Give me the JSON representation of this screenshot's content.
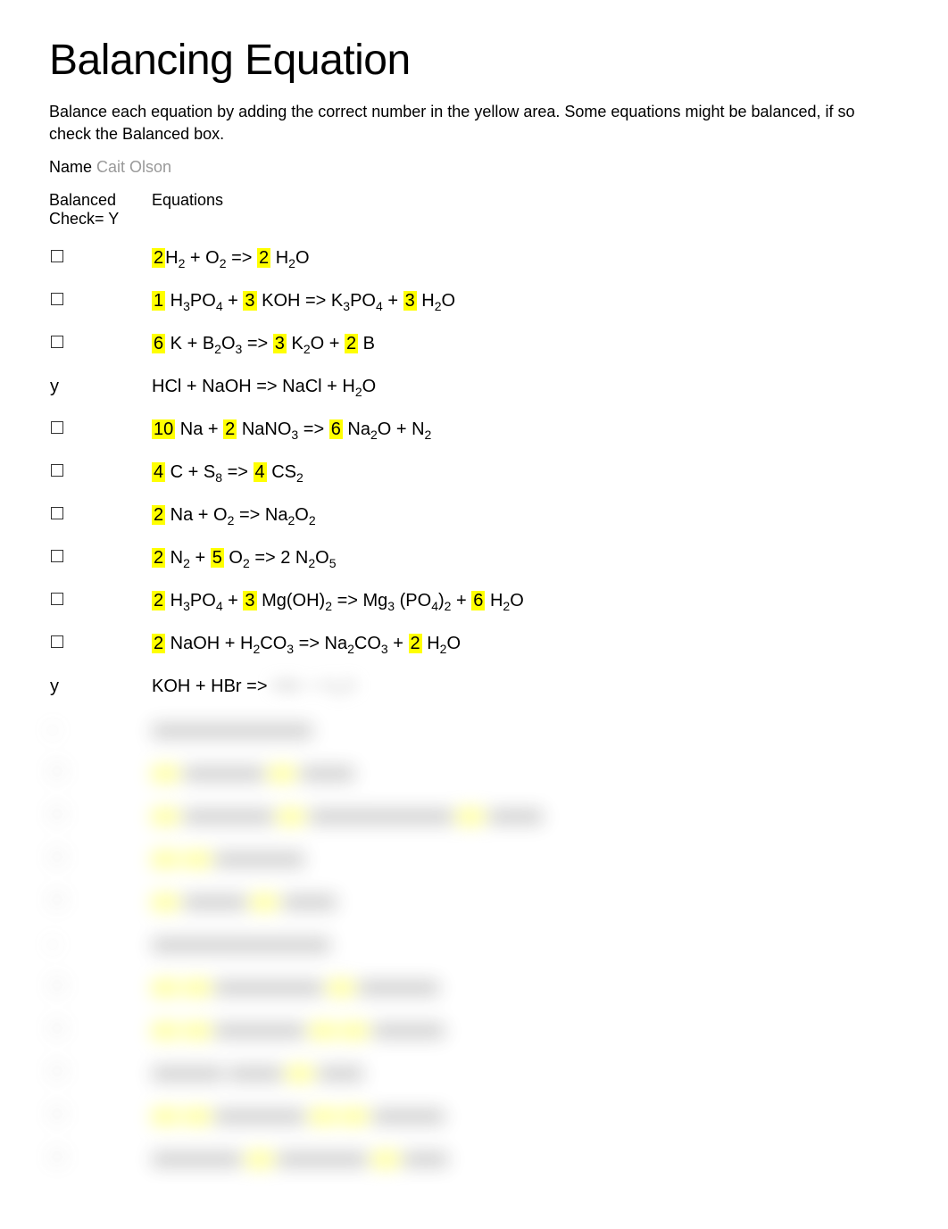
{
  "title": "Balancing Equation",
  "instructions": "Balance each equation by adding the correct number in the yellow area. Some equations might be balanced, if so check the Balanced box.",
  "name_label": "Name",
  "name_value": "Cait Olson",
  "headers": {
    "check": "Balanced Check= Y",
    "equations": "Equations"
  },
  "rows": [
    {
      "check": "box",
      "parts": [
        {
          "hl": true,
          "t": "2"
        },
        {
          "t": "H"
        },
        {
          "sub": "2"
        },
        {
          "t": " +   O"
        },
        {
          "sub": "2"
        },
        {
          "t": " => "
        },
        {
          "hl": true,
          "t": "2"
        },
        {
          "t": " H"
        },
        {
          "sub": "2"
        },
        {
          "t": "O"
        }
      ]
    },
    {
      "check": "box",
      "parts": [
        {
          "hl": true,
          "t": "1"
        },
        {
          "t": " H"
        },
        {
          "sub": "3"
        },
        {
          "t": "PO"
        },
        {
          "sub": "4"
        },
        {
          "t": " + "
        },
        {
          "hl": true,
          "t": "3"
        },
        {
          "t": " KOH  =>   K"
        },
        {
          "sub": "3"
        },
        {
          "t": "PO"
        },
        {
          "sub": "4"
        },
        {
          "t": " + "
        },
        {
          "hl": true,
          "t": "3"
        },
        {
          "t": " H"
        },
        {
          "sub": "2"
        },
        {
          "t": "O"
        }
      ]
    },
    {
      "check": "box",
      "parts": [
        {
          "hl": true,
          "t": "6"
        },
        {
          "t": " K +  B"
        },
        {
          "sub": "2"
        },
        {
          "t": "O"
        },
        {
          "sub": "3"
        },
        {
          "t": "  =>  "
        },
        {
          "hl": true,
          "t": "3"
        },
        {
          "t": " K"
        },
        {
          "sub": "2"
        },
        {
          "t": "O + "
        },
        {
          "hl": true,
          "t": "2"
        },
        {
          "t": " B"
        }
      ]
    },
    {
      "check": "y",
      "parts": [
        {
          "t": "HCl +  NaOH  =>  NaCl +   H"
        },
        {
          "sub": "2"
        },
        {
          "t": "O"
        }
      ]
    },
    {
      "check": "box",
      "parts": [
        {
          "hl": true,
          "t": "10"
        },
        {
          "t": " Na + "
        },
        {
          "hl": true,
          "t": "2"
        },
        {
          "t": " NaNO"
        },
        {
          "sub": "3"
        },
        {
          "t": "  =>  "
        },
        {
          "hl": true,
          "t": "6"
        },
        {
          "t": " Na"
        },
        {
          "sub": "2"
        },
        {
          "t": "O +  N"
        },
        {
          "sub": "2"
        }
      ]
    },
    {
      "check": "box",
      "parts": [
        {
          "hl": true,
          "t": "4"
        },
        {
          "t": " C + S"
        },
        {
          "sub": "8"
        },
        {
          "t": "  =>  "
        },
        {
          "hl": true,
          "t": "4"
        },
        {
          "t": " CS"
        },
        {
          "sub": "2"
        }
      ]
    },
    {
      "check": "box",
      "parts": [
        {
          "hl": true,
          "t": "2"
        },
        {
          "t": " Na + O"
        },
        {
          "sub": "2"
        },
        {
          "t": "  =>   Na"
        },
        {
          "sub": "2"
        },
        {
          "t": "O"
        },
        {
          "sub": "2"
        }
      ]
    },
    {
      "check": "box",
      "parts": [
        {
          "hl": true,
          "t": "2"
        },
        {
          "t": " N"
        },
        {
          "sub": "2"
        },
        {
          "t": " + "
        },
        {
          "hl": true,
          "t": "5"
        },
        {
          "t": " O"
        },
        {
          "sub": "2"
        },
        {
          "t": "  => 2 N"
        },
        {
          "sub": "2"
        },
        {
          "t": "O"
        },
        {
          "sub": "5"
        }
      ]
    },
    {
      "check": "box",
      "parts": [
        {
          "hl": true,
          "t": "2"
        },
        {
          "t": " H"
        },
        {
          "sub": "3"
        },
        {
          "t": "PO"
        },
        {
          "sub": "4"
        },
        {
          "t": " + "
        },
        {
          "hl": true,
          "t": "3"
        },
        {
          "t": " Mg(OH)"
        },
        {
          "sub": "2"
        },
        {
          "t": "  =>    Mg"
        },
        {
          "sub": "3"
        },
        {
          "t": " (PO"
        },
        {
          "sub": "4"
        },
        {
          "t": ")"
        },
        {
          "sub": "2"
        },
        {
          "t": " + "
        },
        {
          "hl": true,
          "t": "6"
        },
        {
          "t": " H"
        },
        {
          "sub": "2"
        },
        {
          "t": "O"
        }
      ]
    },
    {
      "check": "box",
      "parts": [
        {
          "hl": true,
          "t": "2"
        },
        {
          "t": " NaOH + H"
        },
        {
          "sub": "2"
        },
        {
          "t": "CO"
        },
        {
          "sub": "3"
        },
        {
          "t": "  =>    Na"
        },
        {
          "sub": "2"
        },
        {
          "t": "CO"
        },
        {
          "sub": "3"
        },
        {
          "t": " + "
        },
        {
          "hl": true,
          "t": "2"
        },
        {
          "t": " H"
        },
        {
          "sub": "2"
        },
        {
          "t": "O"
        }
      ]
    },
    {
      "check": "y",
      "parts": [
        {
          "t": " KOH + HBr  =>   "
        }
      ],
      "trailing_blur": true
    }
  ],
  "blurred_rows": [
    {
      "check": "blur",
      "yellows": [],
      "widths": [
        180
      ]
    },
    {
      "check": "box",
      "yellows": [
        0,
        2
      ],
      "widths": [
        30,
        90,
        30,
        60
      ]
    },
    {
      "check": "box",
      "yellows": [
        0,
        2,
        4
      ],
      "widths": [
        30,
        100,
        30,
        160,
        30,
        60
      ]
    },
    {
      "check": "box",
      "yellows": [
        0,
        1
      ],
      "widths": [
        30,
        30,
        100
      ]
    },
    {
      "check": "box",
      "yellows": [
        0,
        2
      ],
      "widths": [
        30,
        70,
        30,
        60
      ]
    },
    {
      "check": "blur",
      "yellows": [],
      "widths": [
        200
      ]
    },
    {
      "check": "box",
      "yellows": [
        0,
        1,
        3
      ],
      "widths": [
        30,
        30,
        120,
        30,
        90
      ]
    },
    {
      "check": "box",
      "yellows": [
        0,
        1,
        3,
        4
      ],
      "widths": [
        30,
        30,
        100,
        30,
        30,
        80
      ]
    },
    {
      "check": "box",
      "yellows": [
        2
      ],
      "widths": [
        80,
        60,
        30,
        50
      ]
    },
    {
      "check": "box",
      "yellows": [
        0,
        1,
        3,
        4
      ],
      "widths": [
        30,
        30,
        100,
        30,
        30,
        80
      ]
    },
    {
      "check": "box",
      "yellows": [
        1,
        3
      ],
      "widths": [
        100,
        30,
        100,
        30,
        50
      ]
    }
  ]
}
